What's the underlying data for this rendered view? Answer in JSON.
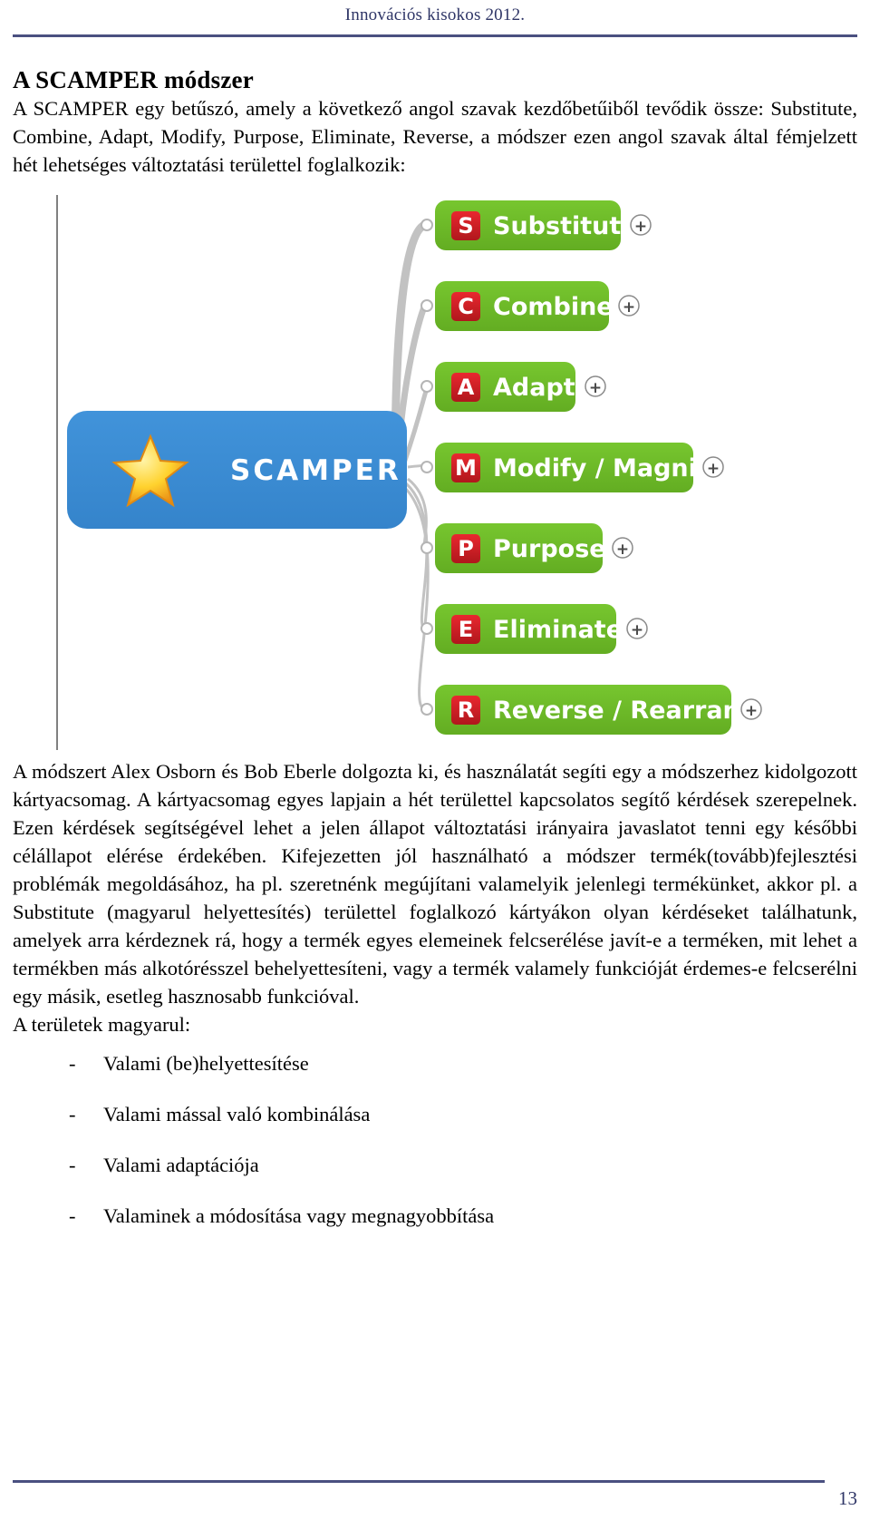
{
  "header": {
    "title": "Innovációs kisokos 2012."
  },
  "page": {
    "title": "A SCAMPER módszer",
    "intro_paragraph": "A SCAMPER egy betűszó, amely a következő angol szavak kezdőbetűiből tevődik össze: Substitute, Combine, Adapt, Modify, Purpose, Eliminate, Reverse, a módszer ezen angol szavak által fémjelzett hét lehetséges változtatási területtel foglalkozik:",
    "body_paragraph": "A módszert Alex Osborn és Bob Eberle dolgozta ki, és használatát segíti egy a módszerhez kidolgozott kártyacsomag. A kártyacsomag egyes lapjain a hét területtel kapcsolatos segítő kérdések szerepelnek. Ezen kérdések segítségével lehet a jelen állapot változtatási irányaira javaslatot tenni egy későbbi célállapot elérése érdekében. Kifejezetten jól használható a módszer termék(tovább)fejlesztési problémák megoldásához, ha pl. szeretnénk megújítani valamelyik jelenlegi termékünket, akkor pl. a Substitute (magyarul helyettesítés) területtel foglalkozó kártyákon olyan kérdéseket találhatunk, amelyek arra kérdeznek rá, hogy a termék egyes elemeinek felcserélése javít-e a terméken, mit lehet a termékben más alkotórésszel behelyettesíteni, vagy a termék valamely funkcióját érdemes-e felcserélni egy másik, esetleg hasznosabb funkcióval.",
    "list_intro": "A területek magyarul:"
  },
  "areas_list": {
    "bullet": "-",
    "items": [
      "Valami (be)helyettesítése",
      "Valami mással való kombinálása",
      "Valami adaptációja",
      "Valaminek a módosítása vagy megnagyobbítása"
    ]
  },
  "figure": {
    "center": {
      "label": "SCAMPER",
      "color": "#3b8fd4",
      "icon": "star-icon"
    },
    "node_color": "#6cb828",
    "badge_color": "#d81f26",
    "plus_label": "+",
    "branches": [
      {
        "letter": "S",
        "label": "Substitute"
      },
      {
        "letter": "C",
        "label": "Combine"
      },
      {
        "letter": "A",
        "label": "Adapt"
      },
      {
        "letter": "M",
        "label": "Modify / Magnify"
      },
      {
        "letter": "P",
        "label": "Purpose"
      },
      {
        "letter": "E",
        "label": "Eliminate"
      },
      {
        "letter": "R",
        "label": "Reverse / Rearrange"
      }
    ]
  },
  "footer": {
    "page_number": "13"
  }
}
